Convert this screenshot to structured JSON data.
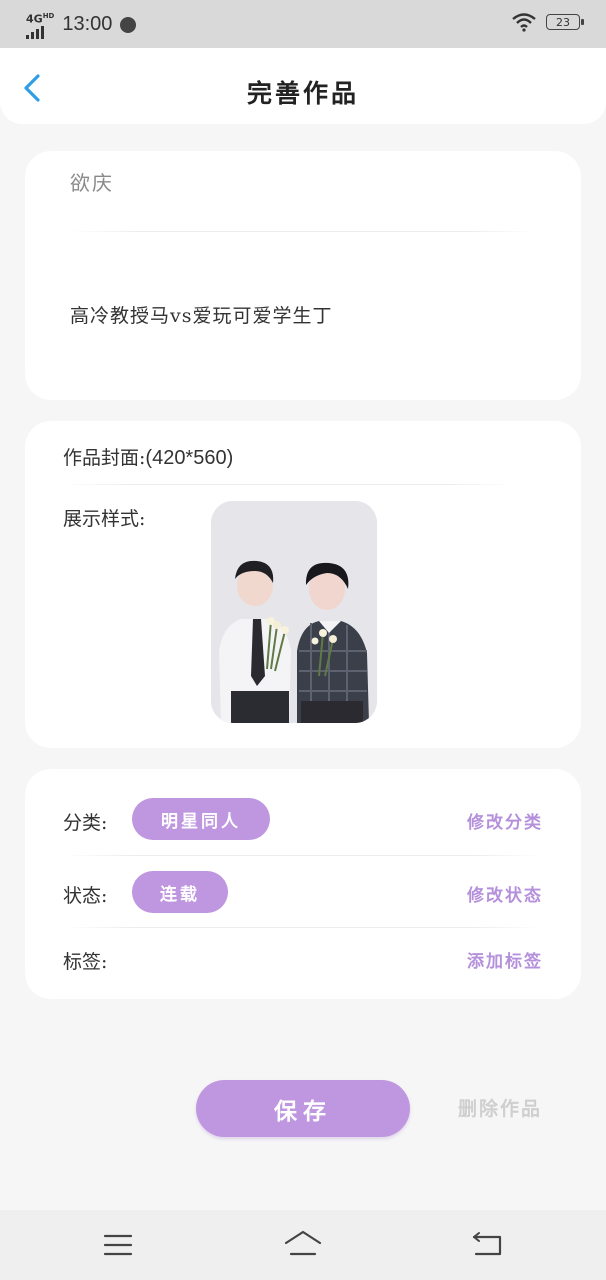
{
  "status_bar": {
    "network": "4G",
    "network_sup": "HD",
    "time": "13:00",
    "battery": "23"
  },
  "header": {
    "title": "完善作品",
    "back_icon": "chevron-left-icon"
  },
  "work": {
    "name_placeholder": "欲庆",
    "synopsis": "高冷教授马vs爱玩可爱学生丁"
  },
  "cover": {
    "label": "作品封面:",
    "size": "(420*560)",
    "display_label": "展示样式:"
  },
  "meta": {
    "category_label": "分类:",
    "category_value": "明星同人",
    "category_action": "修改分类",
    "status_label": "状态:",
    "status_value": "连载",
    "status_action": "修改状态",
    "tags_label": "标签:",
    "tags_action": "添加标签"
  },
  "actions": {
    "save": "保存",
    "delete": "删除作品"
  },
  "nav": {
    "menu_icon": "menu-icon",
    "home_icon": "home-icon",
    "back_icon": "back-icon"
  },
  "colors": {
    "accent": "#bf97e0",
    "accent_text": "#b591dc",
    "back_arrow": "#2f9ee6"
  }
}
